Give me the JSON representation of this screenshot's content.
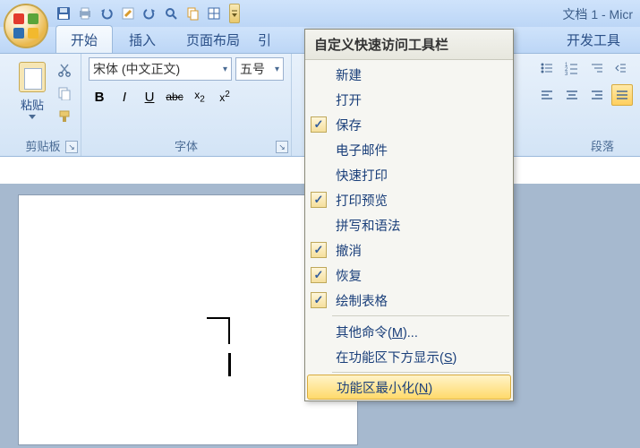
{
  "doc_title": "文档 1 - Micr",
  "qat_icons": [
    "save-icon",
    "print-icon",
    "undo-icon",
    "edit-icon",
    "redo-icon",
    "find-icon",
    "copy-icon",
    "table-icon"
  ],
  "tabs": {
    "start": "开始",
    "insert": "插入",
    "layout": "页面布局",
    "left_cut": "引",
    "dev": "开发工具"
  },
  "ribbon": {
    "clipboard": {
      "paste": "粘贴",
      "label": "剪贴板"
    },
    "font": {
      "name": "宋体 (中文正文)",
      "size": "五号",
      "label": "字体",
      "bold": "B",
      "italic": "I",
      "underline": "U",
      "strike": "abc",
      "sub": "x",
      "sub2": "₂",
      "sup": "x",
      "sup2": "²"
    },
    "para": {
      "label": "段落"
    }
  },
  "menu": {
    "header": "自定义快速访问工具栏",
    "items": [
      {
        "label": "新建",
        "checked": false
      },
      {
        "label": "打开",
        "checked": false
      },
      {
        "label": "保存",
        "checked": true
      },
      {
        "label": "电子邮件",
        "checked": false
      },
      {
        "label": "快速打印",
        "checked": false
      },
      {
        "label": "打印预览",
        "checked": true
      },
      {
        "label": "拼写和语法",
        "checked": false
      },
      {
        "label": "撤消",
        "checked": true
      },
      {
        "label": "恢复",
        "checked": true
      },
      {
        "label": "绘制表格",
        "checked": true
      }
    ],
    "more": {
      "text": "其他命令",
      "accel": "M",
      "suffix": "..."
    },
    "below": {
      "text": "在功能区下方显示",
      "accel": "S"
    },
    "minimize": {
      "text": "功能区最小化",
      "accel": "N"
    }
  },
  "check_glyph": "✓"
}
